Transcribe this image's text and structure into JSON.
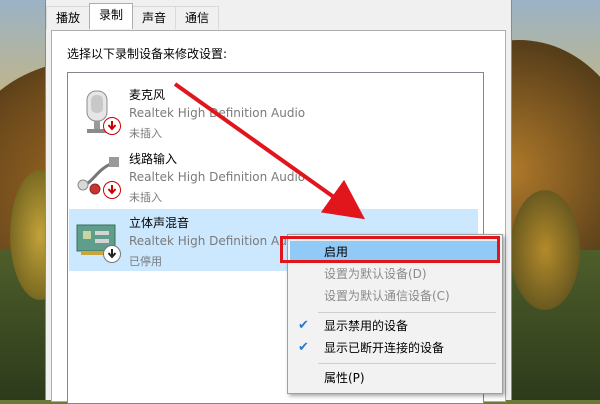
{
  "tabs": [
    {
      "label": "播放"
    },
    {
      "label": "录制"
    },
    {
      "label": "声音"
    },
    {
      "label": "通信"
    }
  ],
  "instruction": "选择以下录制设备来修改设置:",
  "devices": [
    {
      "name": "麦克风",
      "driver": "Realtek High Definition Audio",
      "status": "未插入",
      "icon": "microphone-icon"
    },
    {
      "name": "线路输入",
      "driver": "Realtek High Definition Audio",
      "status": "未插入",
      "icon": "line-in-icon"
    },
    {
      "name": "立体声混音",
      "driver": "Realtek High Definition Audio",
      "status": "已停用",
      "icon": "stereo-mix-icon"
    }
  ],
  "context_menu": {
    "items": [
      {
        "label": "启用",
        "state": "hover"
      },
      {
        "label": "设置为默认设备(D)",
        "state": "disabled"
      },
      {
        "label": "设置为默认通信设备(C)",
        "state": "disabled"
      },
      {
        "label": "显示禁用的设备",
        "checked": true
      },
      {
        "label": "显示已断开连接的设备",
        "checked": true
      },
      {
        "label": "属性(P)"
      }
    ]
  },
  "colors": {
    "selected_row": "#cce8ff",
    "menu_hover": "#91c9f7",
    "annotation_red": "#e0161c"
  }
}
